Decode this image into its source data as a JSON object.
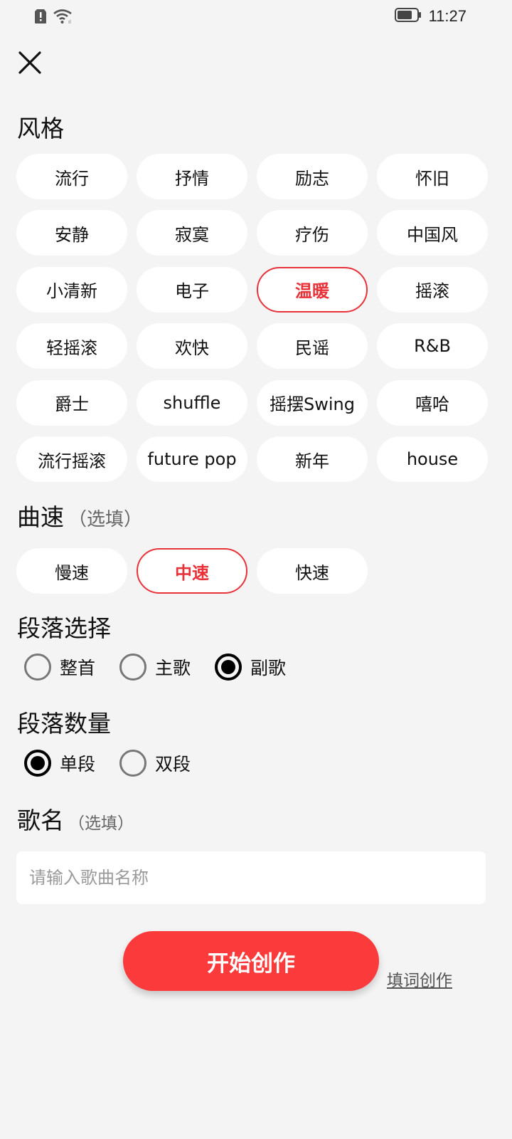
{
  "status_bar": {
    "time": "11:27",
    "icons": [
      "alert-icon",
      "wifi-icon",
      "battery-icon"
    ]
  },
  "close": {
    "icon": "close-icon"
  },
  "style_section": {
    "title": "风格",
    "chips": [
      {
        "label": "流行",
        "selected": false
      },
      {
        "label": "抒情",
        "selected": false
      },
      {
        "label": "励志",
        "selected": false
      },
      {
        "label": "怀旧",
        "selected": false
      },
      {
        "label": "安静",
        "selected": false
      },
      {
        "label": "寂寞",
        "selected": false
      },
      {
        "label": "疗伤",
        "selected": false
      },
      {
        "label": "中国风",
        "selected": false
      },
      {
        "label": "小清新",
        "selected": false
      },
      {
        "label": "电子",
        "selected": false
      },
      {
        "label": "温暖",
        "selected": true
      },
      {
        "label": "摇滚",
        "selected": false
      },
      {
        "label": "轻摇滚",
        "selected": false
      },
      {
        "label": "欢快",
        "selected": false
      },
      {
        "label": "民谣",
        "selected": false
      },
      {
        "label": "R&B",
        "selected": false
      },
      {
        "label": "爵士",
        "selected": false
      },
      {
        "label": "shuffle",
        "selected": false
      },
      {
        "label": "摇摆Swing",
        "selected": false
      },
      {
        "label": "嘻哈",
        "selected": false
      },
      {
        "label": "流行摇滚",
        "selected": false
      },
      {
        "label": "future pop",
        "selected": false
      },
      {
        "label": "新年",
        "selected": false
      },
      {
        "label": "house",
        "selected": false
      }
    ]
  },
  "tempo_section": {
    "title": "曲速",
    "hint": "（选填）",
    "chips": [
      {
        "label": "慢速",
        "selected": false
      },
      {
        "label": "中速",
        "selected": true
      },
      {
        "label": "快速",
        "selected": false
      }
    ]
  },
  "segment_section": {
    "title": "段落选择",
    "options": [
      {
        "label": "整首",
        "checked": false
      },
      {
        "label": "主歌",
        "checked": false
      },
      {
        "label": "副歌",
        "checked": true
      }
    ]
  },
  "count_section": {
    "title": "段落数量",
    "options": [
      {
        "label": "单段",
        "checked": true
      },
      {
        "label": "双段",
        "checked": false
      }
    ]
  },
  "song_name_section": {
    "title": "歌名",
    "hint": "（选填）",
    "placeholder": "请输入歌曲名称",
    "value": ""
  },
  "actions": {
    "start_label": "开始创作",
    "lyric_link_label": "填词创作"
  },
  "colors": {
    "accent": "#fb3a3c",
    "selected_border": "#e8323a",
    "background": "#f4f4f4"
  }
}
